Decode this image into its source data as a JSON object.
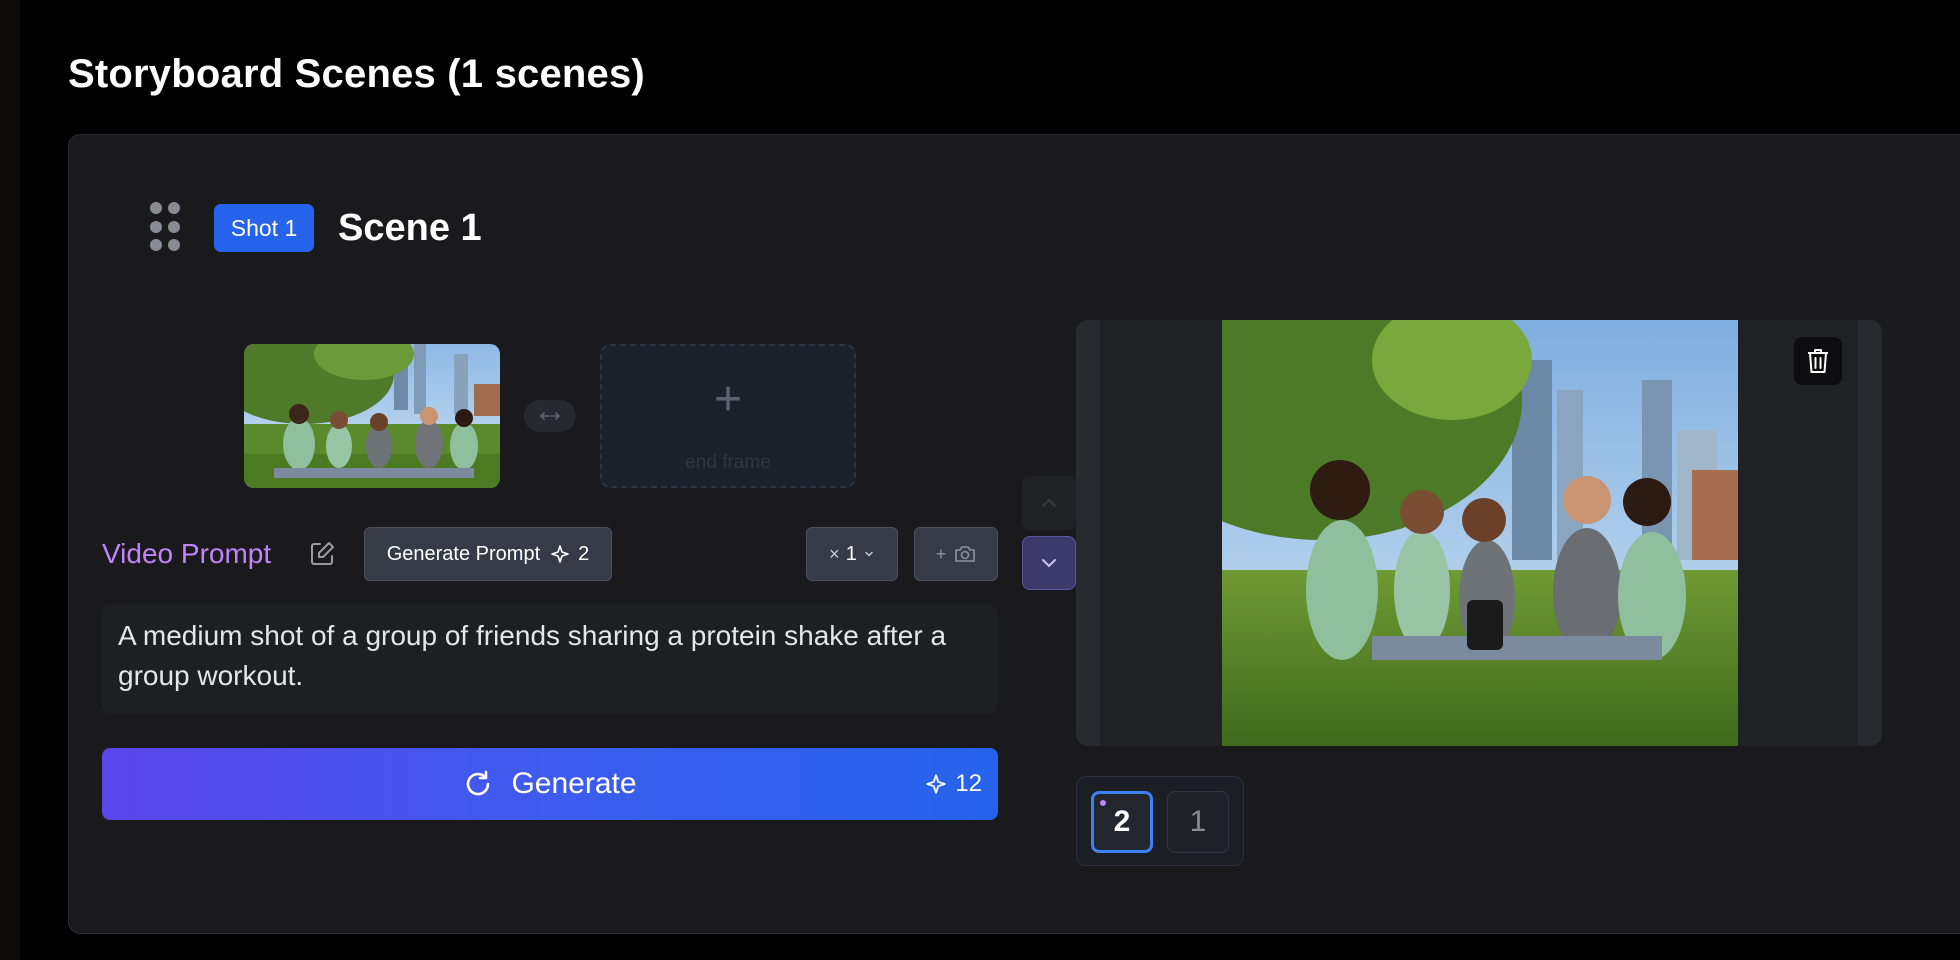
{
  "page": {
    "title": "Storyboard Scenes (1 scenes)"
  },
  "scene": {
    "shot_badge": "Shot 1",
    "title": "Scene 1",
    "end_frame_label": "end frame",
    "video_prompt_label": "Video Prompt",
    "generate_prompt_label": "Generate Prompt",
    "generate_prompt_cost": "2",
    "multiplier": "1",
    "prompt_text": "A medium shot of a group of friends sharing a protein shake after a group workout.",
    "generate_label": "Generate",
    "generate_cost": "12"
  },
  "versions": [
    {
      "label": "2",
      "selected": true
    },
    {
      "label": "1",
      "selected": false
    }
  ],
  "colors": {
    "accent": "#2563eb",
    "prompt_label": "#c084fc",
    "gradient_start": "#5b45eb",
    "gradient_end": "#2563eb"
  },
  "icons": [
    "drag-handle-icon",
    "swap-arrows-icon",
    "plus-icon",
    "edit-icon",
    "sparkle-icon",
    "close-icon",
    "chevron-down-icon",
    "camera-icon",
    "refresh-icon",
    "trash-icon",
    "chevron-up-icon"
  ]
}
